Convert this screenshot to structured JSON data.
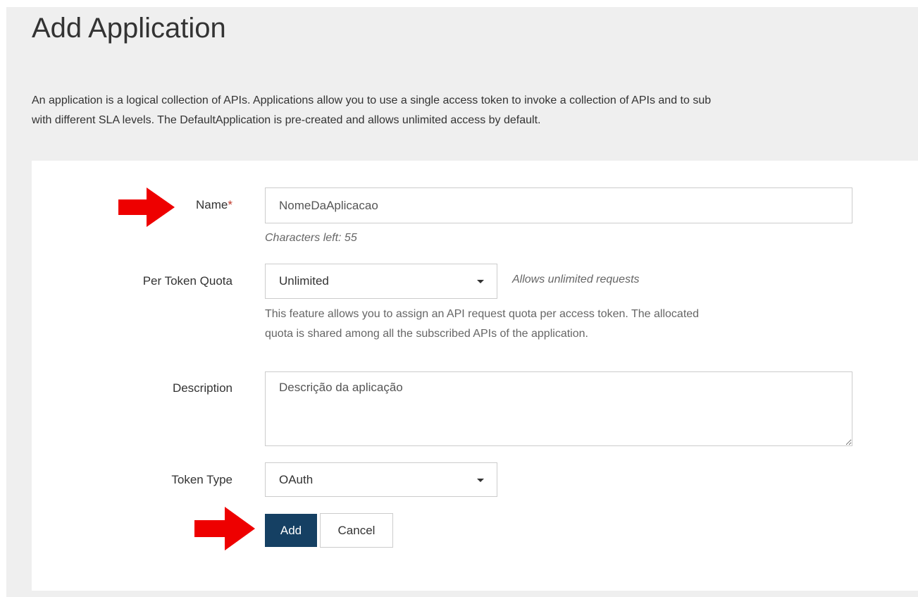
{
  "page": {
    "title": "Add Application",
    "intro_line1": "An application is a logical collection of APIs. Applications allow you to use a single access token to invoke a collection of APIs and to sub",
    "intro_line2": "with different SLA levels. The DefaultApplication is pre-created and allows unlimited access by default."
  },
  "form": {
    "name": {
      "label": "Name",
      "required_mark": "*",
      "value": "NomeDaAplicacao",
      "chars_left": "Characters left: 55"
    },
    "quota": {
      "label": "Per Token Quota",
      "selected": "Unlimited",
      "hint": "Allows unlimited requests",
      "help_line1": "This feature allows you to assign an API request quota per access token. The allocated",
      "help_line2": "quota is shared among all the subscribed APIs of the application."
    },
    "description": {
      "label": "Description",
      "value": "Descrição da aplicação"
    },
    "token_type": {
      "label": "Token Type",
      "selected": "OAuth"
    },
    "actions": {
      "add_label": "Add",
      "cancel_label": "Cancel"
    }
  },
  "colors": {
    "primary_button": "#154063",
    "annotation_arrow": "#ee0000",
    "required_mark": "#c0392b"
  },
  "icons": [
    "red-arrow-annotation-icon",
    "chevron-down-icon"
  ]
}
